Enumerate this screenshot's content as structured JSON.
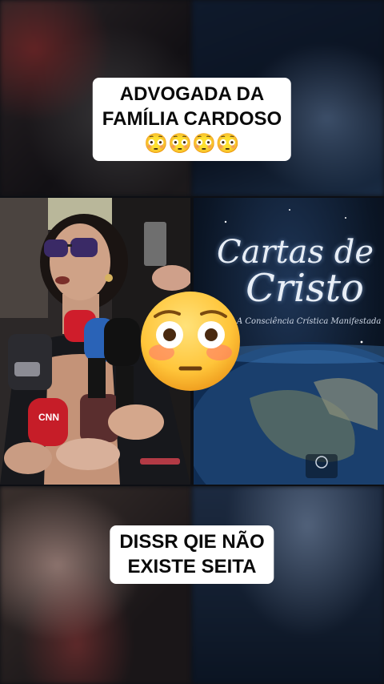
{
  "captions": {
    "top_line1": "ADVOGADA DA",
    "top_line2": "FAMÍLIA CARDOSO",
    "top_emojis": "😳😳😳😳",
    "bottom_line1": "DISSR QIE NÃO",
    "bottom_line2": "EXISTE SEITA"
  },
  "book": {
    "title_line1": "Cartas de",
    "title_line2": "Cristo",
    "subtitle": "A Consciência Crística Manifestada"
  },
  "overlay_emoji": "flushed-face-emoji"
}
